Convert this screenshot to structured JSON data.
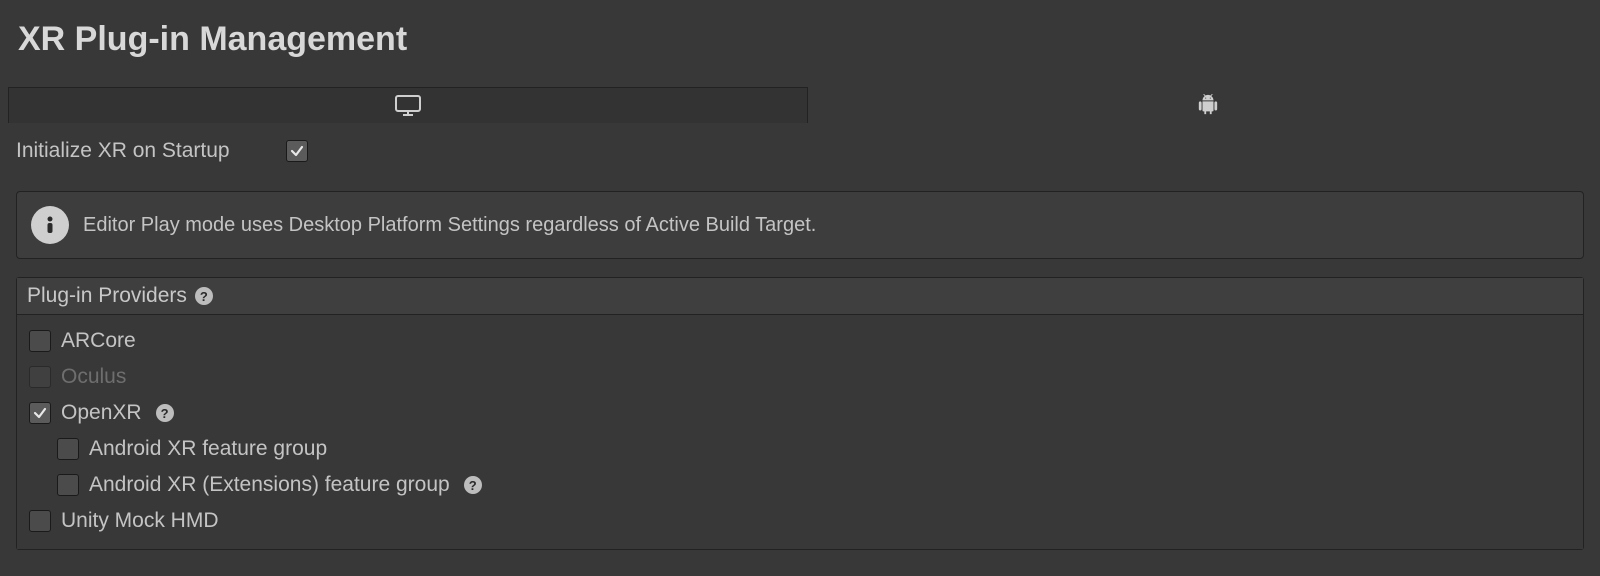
{
  "panel": {
    "title": "XR Plug-in Management"
  },
  "tabs": {
    "desktop": {
      "name": "desktop",
      "active": true
    },
    "android": {
      "name": "android",
      "active": false
    }
  },
  "initialize": {
    "label": "Initialize XR on Startup",
    "checked": true
  },
  "notice": {
    "text": "Editor Play mode uses Desktop Platform Settings regardless of Active Build Target."
  },
  "providers": {
    "header": "Plug-in Providers",
    "items": [
      {
        "name": "arcore",
        "label": "ARCore",
        "checked": false,
        "disabled": false,
        "help": false,
        "indent": 0
      },
      {
        "name": "oculus",
        "label": "Oculus",
        "checked": false,
        "disabled": true,
        "help": false,
        "indent": 0
      },
      {
        "name": "openxr",
        "label": "OpenXR",
        "checked": true,
        "disabled": false,
        "help": true,
        "indent": 0
      },
      {
        "name": "androidxr",
        "label": "Android XR feature group",
        "checked": false,
        "disabled": false,
        "help": false,
        "indent": 1
      },
      {
        "name": "androidxre",
        "label": "Android XR (Extensions) feature group",
        "checked": false,
        "disabled": false,
        "help": true,
        "indent": 1
      },
      {
        "name": "mockhmd",
        "label": "Unity Mock HMD",
        "checked": false,
        "disabled": false,
        "help": false,
        "indent": 0
      }
    ]
  }
}
